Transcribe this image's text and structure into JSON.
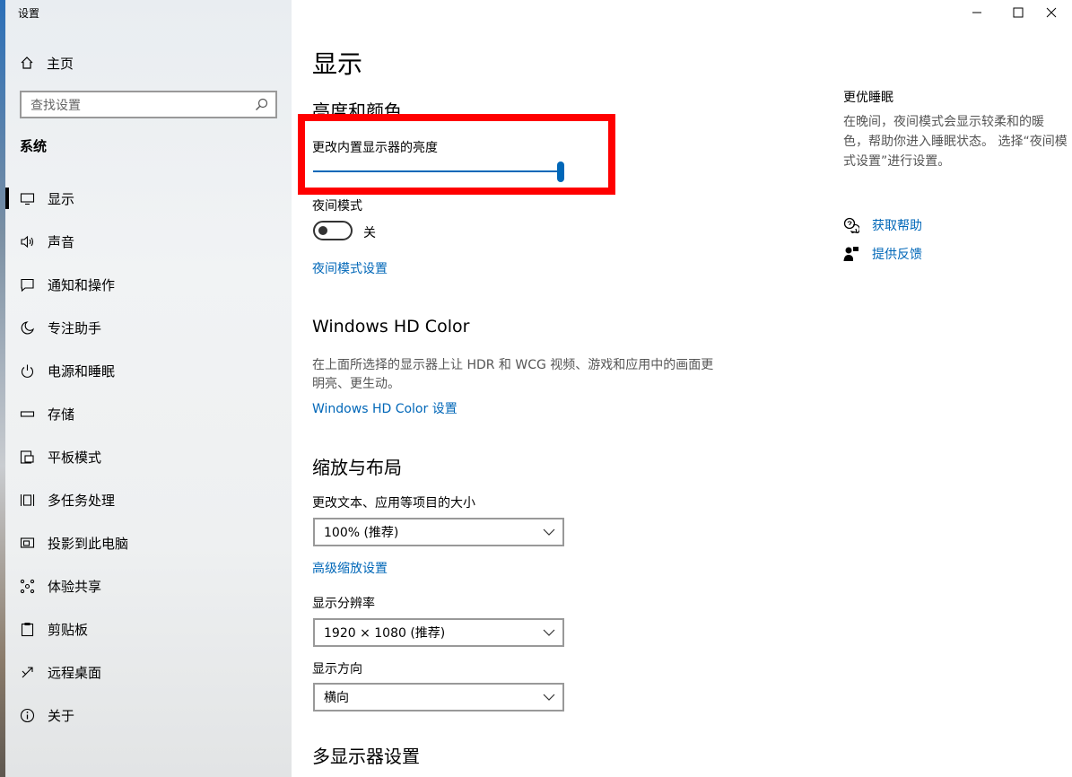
{
  "window": {
    "title": "设置"
  },
  "sidebar": {
    "home_label": "主页",
    "search_placeholder": "查找设置",
    "section": "系统",
    "items": [
      {
        "label": "显示",
        "icon": "monitor-icon",
        "active": true
      },
      {
        "label": "声音",
        "icon": "speaker-icon"
      },
      {
        "label": "通知和操作",
        "icon": "notification-icon"
      },
      {
        "label": "专注助手",
        "icon": "moon-icon"
      },
      {
        "label": "电源和睡眠",
        "icon": "power-icon"
      },
      {
        "label": "存储",
        "icon": "storage-icon"
      },
      {
        "label": "平板模式",
        "icon": "tablet-icon"
      },
      {
        "label": "多任务处理",
        "icon": "multitask-icon"
      },
      {
        "label": "投影到此电脑",
        "icon": "project-icon"
      },
      {
        "label": "体验共享",
        "icon": "share-icon"
      },
      {
        "label": "剪贴板",
        "icon": "clipboard-icon"
      },
      {
        "label": "远程桌面",
        "icon": "remote-desktop-icon"
      },
      {
        "label": "关于",
        "icon": "info-icon"
      }
    ]
  },
  "main": {
    "title": "显示",
    "brightness_section": "亮度和颜色",
    "brightness_label": "更改内置显示器的亮度",
    "brightness_value": 1.0,
    "night_mode_label": "夜间模式",
    "night_mode_state": "关",
    "night_mode_link": "夜间模式设置",
    "hdr_title": "Windows HD Color",
    "hdr_desc": "在上面所选择的显示器上让 HDR 和 WCG 视频、游戏和应用中的画面更明亮、更生动。",
    "hdr_link": "Windows HD Color 设置",
    "scale_section": "缩放与布局",
    "scale_label": "更改文本、应用等项目的大小",
    "scale_value": "100% (推荐)",
    "advanced_scale_link": "高级缩放设置",
    "resolution_label": "显示分辨率",
    "resolution_value": "1920 × 1080 (推荐)",
    "orientation_label": "显示方向",
    "orientation_value": "横向",
    "multi_display_section": "多显示器设置"
  },
  "right_panel": {
    "title": "更优睡眠",
    "desc": "在晚间，夜间模式会显示较柔和的暖色，帮助你进入睡眠状态。 选择“夜间模式设置”进行设置。",
    "help_link": "获取帮助",
    "feedback_link": "提供反馈"
  },
  "colors": {
    "accent": "#0067b8",
    "highlight": "#ff0000"
  }
}
